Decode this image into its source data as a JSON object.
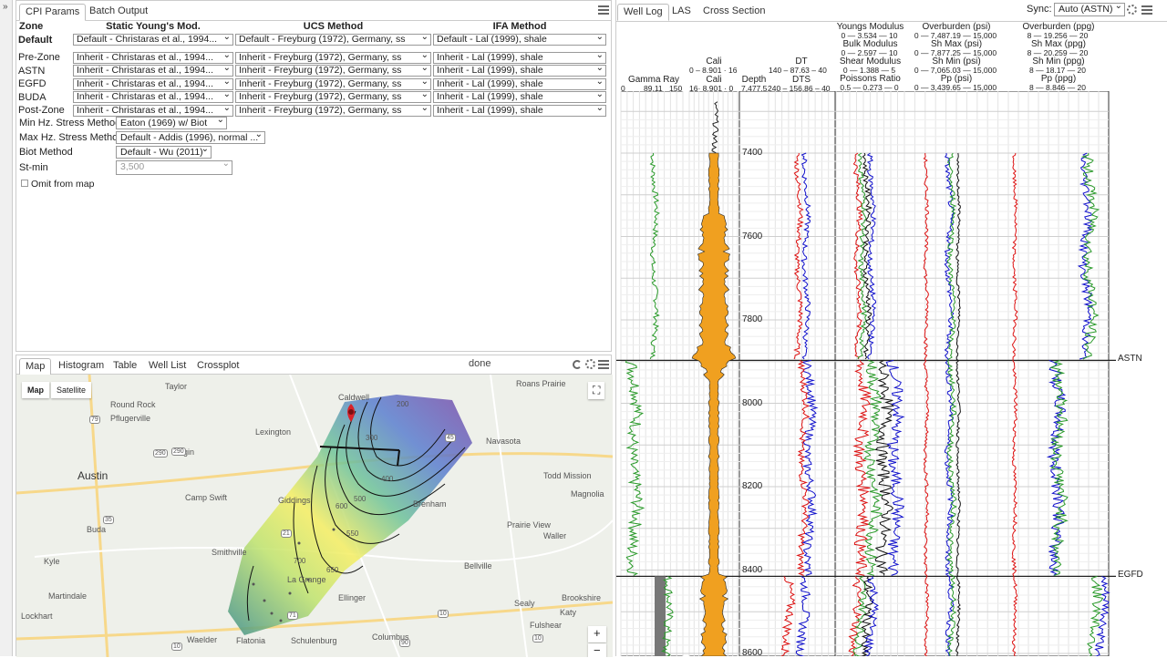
{
  "sidebar_toggle": "»",
  "top_left_panel": {
    "tabs": [
      {
        "label": "CPI Params"
      },
      {
        "label": "Batch Output"
      }
    ],
    "headers": {
      "zone": "Zone",
      "youngs": "Static Young's Mod.",
      "ucs": "UCS Method",
      "ifa": "IFA Method"
    },
    "rows": [
      {
        "zone": "Default",
        "youngs": "Default - Christaras et al., 1994...",
        "ucs": "Default - Freyburg (1972), Germany, ss",
        "ifa": "Default - Lal (1999), shale"
      },
      {
        "zone": "Pre-Zone",
        "youngs": "Inherit - Christaras et al., 1994...",
        "ucs": "Inherit - Freyburg (1972), Germany, ss",
        "ifa": "Inherit - Lal (1999), shale"
      },
      {
        "zone": "ASTN",
        "youngs": "Inherit - Christaras et al., 1994...",
        "ucs": "Inherit - Freyburg (1972), Germany, ss",
        "ifa": "Inherit - Lal (1999), shale"
      },
      {
        "zone": "EGFD",
        "youngs": "Inherit - Christaras et al., 1994...",
        "ucs": "Inherit - Freyburg (1972), Germany, ss",
        "ifa": "Inherit - Lal (1999), shale"
      },
      {
        "zone": "BUDA",
        "youngs": "Inherit - Christaras et al., 1994...",
        "ucs": "Inherit - Freyburg (1972), Germany, ss",
        "ifa": "Inherit - Lal (1999), shale"
      },
      {
        "zone": "Post-Zone",
        "youngs": "Inherit - Christaras et al., 1994...",
        "ucs": "Inherit - Freyburg (1972), Germany, ss",
        "ifa": "Inherit - Lal (1999), shale"
      }
    ],
    "options": {
      "min_hz_label": "Min Hz. Stress Method",
      "min_hz_value": "Eaton (1969) w/ Biot",
      "max_hz_label": "Max Hz. Stress Method",
      "max_hz_value": "Default - Addis (1996), normal ...",
      "biot_label": "Biot Method",
      "biot_value": "Default - Wu (2011)",
      "stmin_label": "St-min",
      "stmin_placeholder": "3,500",
      "omit_label": "Omit from map"
    }
  },
  "bottom_left_panel": {
    "tabs": [
      {
        "label": "Map"
      },
      {
        "label": "Histogram"
      },
      {
        "label": "Table"
      },
      {
        "label": "Well List"
      },
      {
        "label": "Crossplot"
      }
    ],
    "status": "done",
    "map_type": {
      "map": "Map",
      "satellite": "Satellite"
    },
    "zoom_in": "+",
    "zoom_out": "−",
    "places": [
      "Taylor",
      "Round Rock",
      "Pflugerville",
      "Lexington",
      "Caldwell",
      "Roans Prairie",
      "Elgin",
      "Austin",
      "Navasota",
      "Todd Mission",
      "Camp Swift",
      "Giddings",
      "Brenham",
      "Magnolia",
      "Buda",
      "Prairie View",
      "Smithville",
      "Waller",
      "Bellville",
      "Kyle",
      "La Grange",
      "Martindale",
      "Ellinger",
      "Sealy",
      "Brookshire",
      "Lockhart",
      "Fulshear",
      "Katy",
      "Flatonia",
      "Schulenburg",
      "Columbus",
      "Waelder"
    ],
    "contours": [
      "200",
      "300",
      "400",
      "500",
      "550",
      "600",
      "650",
      "700"
    ],
    "highways": [
      "79",
      "290",
      "35",
      "21",
      "71",
      "290",
      "45",
      "10",
      "90",
      "10",
      "10"
    ]
  },
  "right_panel": {
    "tabs": [
      {
        "label": "Well Log"
      },
      {
        "label": "LAS"
      },
      {
        "label": "Cross Section"
      }
    ],
    "sync_label": "Sync:",
    "sync_value": "Auto (ASTN)",
    "tracks": {
      "gamma": {
        "name": "Gamma Ray",
        "min": "0",
        "val": "89.11",
        "max": "150"
      },
      "cali": {
        "name1": "Cali",
        "s1": "0 – 8.901 · 16",
        "name2": "Cali",
        "s2": "16· 8.901 · 0"
      },
      "depth": {
        "name": "Depth",
        "val": "7,477.5"
      },
      "dt": {
        "name1": "DT",
        "s1": "140 – 87.63 – 40",
        "name2": "DTS",
        "s2": "240 – 156.86 – 40"
      },
      "mod": [
        {
          "name": "Youngs Modulus",
          "s": "0 — 3.534 — 10"
        },
        {
          "name": "Bulk Modulus",
          "s": "0 — 2.597 — 10"
        },
        {
          "name": "Shear Modulus",
          "s": "0 — 1.388 — 5"
        },
        {
          "name": "Poissons Ratio",
          "s": "0.5 — 0.273 — 0"
        }
      ],
      "psi": [
        {
          "name": "Overburden (psi)",
          "s": "0 — 7,487.19 — 15,000"
        },
        {
          "name": "Sh Max (psi)",
          "s": "0 — 7,877.25 — 15,000"
        },
        {
          "name": "Sh Min (psi)",
          "s": "0 — 7,065.03 — 15,000"
        },
        {
          "name": "Pp (psi)",
          "s": "0 — 3,439.65 — 15,000"
        }
      ],
      "ppg": [
        {
          "name": "Overburden (ppg)",
          "s": "8 — 19.256 — 20"
        },
        {
          "name": "Sh Max (ppg)",
          "s": "8 — 20.259 — 20"
        },
        {
          "name": "Sh Min (ppg)",
          "s": "8 — 18.17 — 20"
        },
        {
          "name": "Pp (ppg)",
          "s": "8 — 8.846 — 20"
        }
      ]
    },
    "depth_ticks": [
      "7400",
      "7600",
      "7800",
      "8000",
      "8200",
      "8400",
      "8600"
    ],
    "zone_markers": [
      "ASTN",
      "EGFD"
    ]
  }
}
